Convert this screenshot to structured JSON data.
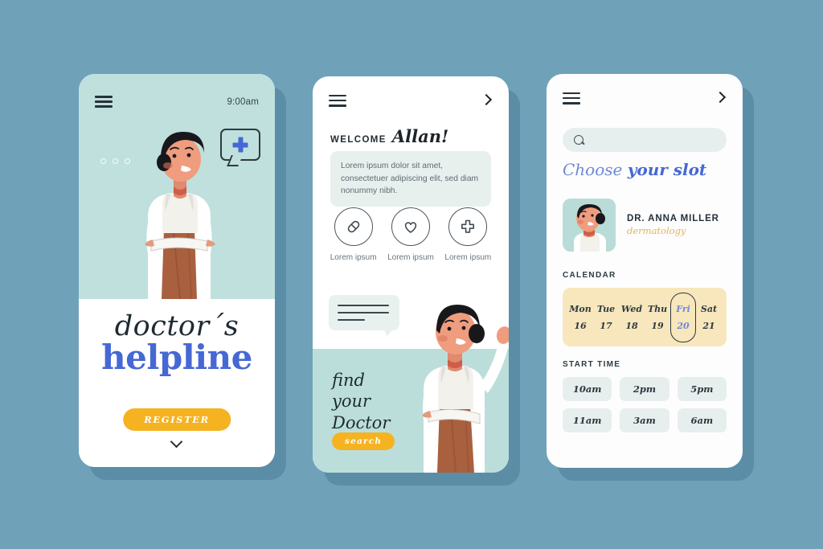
{
  "background_color": "#6fa2b9",
  "theme": {
    "mint": "#bfe0dd",
    "blue": "#4668d4",
    "yellow": "#f5b321",
    "cream": "#f8e7bc",
    "ink": "#1e2a32"
  },
  "screen1": {
    "menu_icon": "hamburger-icon",
    "time": "9:00am",
    "pagination_dots": 3,
    "speech_bubble_icon": "medical-cross-icon",
    "title_line1": "doctor´s",
    "title_line2": "helpline",
    "register_label": "REGISTER",
    "scroll_icon": "chevron-down-icon",
    "illustration": "doctor-arms-crossed-illustration"
  },
  "screen2": {
    "menu_icon": "hamburger-icon",
    "forward_icon": "chevron-right-icon",
    "welcome_small": "WELCOME",
    "welcome_name": "Allan!",
    "info_text": "Lorem ipsum dolor sit amet, consectetuer adipiscing elit, sed diam nonummy nibh.",
    "quick_actions": [
      {
        "icon": "pill-icon",
        "label": "Lorem\nipsum"
      },
      {
        "icon": "heart-icon",
        "label": "Lorem\nipsum"
      },
      {
        "icon": "cross-icon",
        "label": "Lorem\nipsum"
      }
    ],
    "chat_bubble": "message-lines-bubble",
    "find_line1": "find",
    "find_line2": "your",
    "find_line3": "Doctor",
    "search_label": "search",
    "illustration": "doctor-pointing-illustration"
  },
  "screen3": {
    "menu_icon": "hamburger-icon",
    "forward_icon": "chevron-right-icon",
    "search_placeholder": "",
    "search_icon": "magnifier-icon",
    "title_part1": "Choose ",
    "title_part2": "your slot",
    "doctor_name": "DR. ANNA MILLER",
    "doctor_specialty": "dermatology",
    "doctor_avatar": "doctor-portrait-avatar",
    "calendar_label": "CALENDAR",
    "calendar_days": [
      {
        "day": "Mon",
        "date": "16",
        "selected": false
      },
      {
        "day": "Tue",
        "date": "17",
        "selected": false
      },
      {
        "day": "Wed",
        "date": "18",
        "selected": false
      },
      {
        "day": "Thu",
        "date": "19",
        "selected": false
      },
      {
        "day": "Fri",
        "date": "20",
        "selected": true
      },
      {
        "day": "Sat",
        "date": "21",
        "selected": false
      }
    ],
    "start_time_label": "START TIME",
    "time_slots": [
      "10am",
      "2pm",
      "5pm",
      "11am",
      "3am",
      "6am"
    ]
  }
}
